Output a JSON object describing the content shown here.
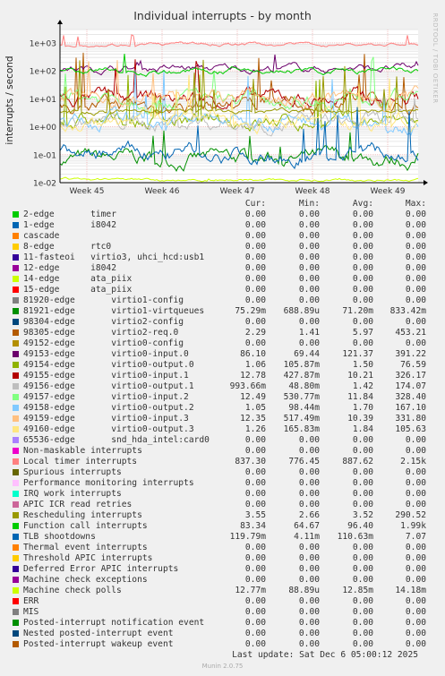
{
  "title": "Individual interrupts - by month",
  "watermark": "RRDTOOL / TOBI OETIKER",
  "footer": "Munin 2.0.75",
  "last_update": "Last update: Sat Dec  6 05:00:12 2025",
  "legend_headers": [
    "Cur:",
    "Min:",
    "Avg:",
    "Max:"
  ],
  "chart_data": {
    "type": "line",
    "title": "Individual interrupts - by month",
    "ylabel": "interrupts / second",
    "yscale": "log",
    "ylim": [
      0.01,
      3000
    ],
    "yticks": [
      {
        "value": 0.01,
        "label": "1e-02"
      },
      {
        "value": 0.1,
        "label": "1e-01"
      },
      {
        "value": 1,
        "label": "1e+00"
      },
      {
        "value": 10,
        "label": "1e+01"
      },
      {
        "value": 100,
        "label": "1e+02"
      },
      {
        "value": 1000,
        "label": "1e+03"
      }
    ],
    "xticks": [
      "Week 45",
      "Week 46",
      "Week 47",
      "Week 48",
      "Week 49"
    ],
    "grid": true,
    "series": [
      {
        "name": "2-edge       timer",
        "color": "#00cc00",
        "cur": "0.00",
        "min": "0.00",
        "avg": "0.00",
        "max": "0.00"
      },
      {
        "name": "1-edge       i8042",
        "color": "#0066b3",
        "cur": "0.00",
        "min": "0.00",
        "avg": "0.00",
        "max": "0.00"
      },
      {
        "name": "cascade",
        "color": "#ff8000",
        "cur": "0.00",
        "min": "0.00",
        "avg": "0.00",
        "max": "0.00"
      },
      {
        "name": "8-edge       rtc0",
        "color": "#ffcc00",
        "cur": "0.00",
        "min": "0.00",
        "avg": "0.00",
        "max": "0.00"
      },
      {
        "name": "11-fasteoi   virtio3, uhci_hcd:usb1",
        "color": "#330099",
        "cur": "0.00",
        "min": "0.00",
        "avg": "0.00",
        "max": "0.00"
      },
      {
        "name": "12-edge      i8042",
        "color": "#990099",
        "cur": "0.00",
        "min": "0.00",
        "avg": "0.00",
        "max": "0.00"
      },
      {
        "name": "14-edge      ata_piix",
        "color": "#ccff00",
        "cur": "0.00",
        "min": "0.00",
        "avg": "0.00",
        "max": "0.00"
      },
      {
        "name": "15-edge      ata_piix",
        "color": "#ff0000",
        "cur": "0.00",
        "min": "0.00",
        "avg": "0.00",
        "max": "0.00"
      },
      {
        "name": "81920-edge       virtio1-config",
        "color": "#808080",
        "cur": "0.00",
        "min": "0.00",
        "avg": "0.00",
        "max": "0.00"
      },
      {
        "name": "81921-edge       virtio1-virtqueues",
        "color": "#008f00",
        "cur": "75.29m",
        "min": "688.89u",
        "avg": "71.20m",
        "max": "833.42m"
      },
      {
        "name": "98304-edge       virtio2-config",
        "color": "#00487d",
        "cur": "0.00",
        "min": "0.00",
        "avg": "0.00",
        "max": "0.00"
      },
      {
        "name": "98305-edge       virtio2-req.0",
        "color": "#b35a00",
        "cur": "2.29",
        "min": "1.41",
        "avg": "5.97",
        "max": "453.21"
      },
      {
        "name": "49152-edge       virtio0-config",
        "color": "#b38f00",
        "cur": "0.00",
        "min": "0.00",
        "avg": "0.00",
        "max": "0.00"
      },
      {
        "name": "49153-edge       virtio0-input.0",
        "color": "#6b006b",
        "cur": "86.10",
        "min": "69.44",
        "avg": "121.37",
        "max": "391.22"
      },
      {
        "name": "49154-edge       virtio0-output.0",
        "color": "#8fb300",
        "cur": "1.06",
        "min": "105.87m",
        "avg": "1.50",
        "max": "76.59"
      },
      {
        "name": "49155-edge       virtio0-input.1",
        "color": "#b30000",
        "cur": "12.78",
        "min": "427.87m",
        "avg": "10.21",
        "max": "326.17"
      },
      {
        "name": "49156-edge       virtio0-output.1",
        "color": "#bebebe",
        "cur": "993.66m",
        "min": "48.80m",
        "avg": "1.42",
        "max": "174.07"
      },
      {
        "name": "49157-edge       virtio0-input.2",
        "color": "#80ff80",
        "cur": "12.49",
        "min": "530.77m",
        "avg": "11.84",
        "max": "328.40"
      },
      {
        "name": "49158-edge       virtio0-output.2",
        "color": "#80c9ff",
        "cur": "1.05",
        "min": "98.44m",
        "avg": "1.70",
        "max": "167.10"
      },
      {
        "name": "49159-edge       virtio0-input.3",
        "color": "#ffc080",
        "cur": "12.35",
        "min": "517.49m",
        "avg": "10.39",
        "max": "331.80"
      },
      {
        "name": "49160-edge       virtio0-output.3",
        "color": "#ffe680",
        "cur": "1.26",
        "min": "165.83m",
        "avg": "1.84",
        "max": "105.63"
      },
      {
        "name": "65536-edge       snd_hda_intel:card0",
        "color": "#aa80ff",
        "cur": "0.00",
        "min": "0.00",
        "avg": "0.00",
        "max": "0.00"
      },
      {
        "name": "Non-maskable interrupts",
        "color": "#ee00cc",
        "cur": "0.00",
        "min": "0.00",
        "avg": "0.00",
        "max": "0.00"
      },
      {
        "name": "Local timer interrupts",
        "color": "#ff8080",
        "cur": "837.30",
        "min": "776.45",
        "avg": "887.62",
        "max": "2.15k"
      },
      {
        "name": "Spurious interrupts",
        "color": "#666600",
        "cur": "0.00",
        "min": "0.00",
        "avg": "0.00",
        "max": "0.00"
      },
      {
        "name": "Performance monitoring interrupts",
        "color": "#ffbfff",
        "cur": "0.00",
        "min": "0.00",
        "avg": "0.00",
        "max": "0.00"
      },
      {
        "name": "IRQ work interrupts",
        "color": "#00ffcc",
        "cur": "0.00",
        "min": "0.00",
        "avg": "0.00",
        "max": "0.00"
      },
      {
        "name": "APIC ICR read retries",
        "color": "#cc6699",
        "cur": "0.00",
        "min": "0.00",
        "avg": "0.00",
        "max": "0.00"
      },
      {
        "name": "Rescheduling interrupts",
        "color": "#999900",
        "cur": "3.55",
        "min": "2.66",
        "avg": "3.52",
        "max": "290.52"
      },
      {
        "name": "Function call interrupts",
        "color": "#00cc00",
        "cur": "83.34",
        "min": "64.67",
        "avg": "96.40",
        "max": "1.99k"
      },
      {
        "name": "TLB shootdowns",
        "color": "#0066b3",
        "cur": "119.79m",
        "min": "4.11m",
        "avg": "110.63m",
        "max": "7.07"
      },
      {
        "name": "Thermal event interrupts",
        "color": "#ff8000",
        "cur": "0.00",
        "min": "0.00",
        "avg": "0.00",
        "max": "0.00"
      },
      {
        "name": "Threshold APIC interrupts",
        "color": "#ffcc00",
        "cur": "0.00",
        "min": "0.00",
        "avg": "0.00",
        "max": "0.00"
      },
      {
        "name": "Deferred Error APIC interrupts",
        "color": "#330099",
        "cur": "0.00",
        "min": "0.00",
        "avg": "0.00",
        "max": "0.00"
      },
      {
        "name": "Machine check exceptions",
        "color": "#990099",
        "cur": "0.00",
        "min": "0.00",
        "avg": "0.00",
        "max": "0.00"
      },
      {
        "name": "Machine check polls",
        "color": "#ccff00",
        "cur": "12.77m",
        "min": "88.89u",
        "avg": "12.85m",
        "max": "14.18m"
      },
      {
        "name": "ERR",
        "color": "#ff0000",
        "cur": "0.00",
        "min": "0.00",
        "avg": "0.00",
        "max": "0.00"
      },
      {
        "name": "MIS",
        "color": "#808080",
        "cur": "0.00",
        "min": "0.00",
        "avg": "0.00",
        "max": "0.00"
      },
      {
        "name": "Posted-interrupt notification event",
        "color": "#008f00",
        "cur": "0.00",
        "min": "0.00",
        "avg": "0.00",
        "max": "0.00"
      },
      {
        "name": "Nested posted-interrupt event",
        "color": "#00487d",
        "cur": "0.00",
        "min": "0.00",
        "avg": "0.00",
        "max": "0.00"
      },
      {
        "name": "Posted-interrupt wakeup event",
        "color": "#b35a00",
        "cur": "0.00",
        "min": "0.00",
        "avg": "0.00",
        "max": "0.00"
      }
    ]
  }
}
